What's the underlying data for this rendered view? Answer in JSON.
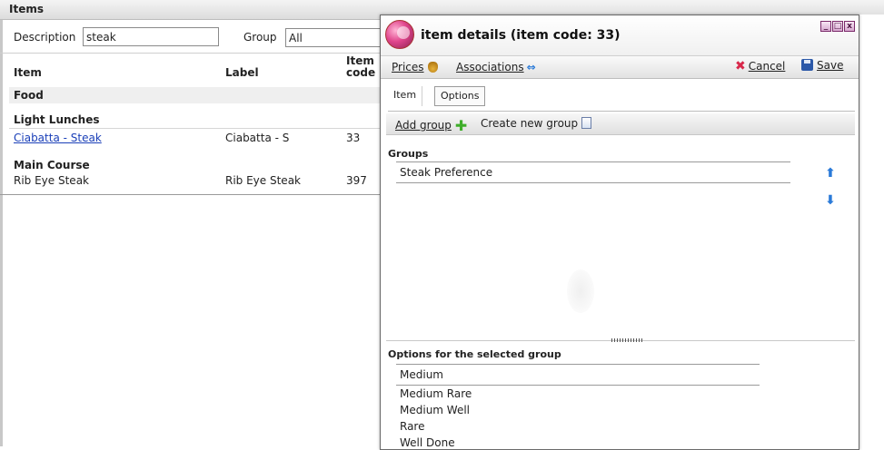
{
  "items_window": {
    "title": "Items",
    "filter": {
      "description_label": "Description",
      "description_value": "steak",
      "group_label": "Group",
      "group_value": "All"
    },
    "columns": {
      "item": "Item",
      "label": "Label",
      "item_code_line1": "Item",
      "item_code_line2": "code"
    },
    "group_name": "Food",
    "sections": [
      {
        "name": "Light Lunches",
        "rows": [
          {
            "item": "Ciabatta - Steak",
            "label": "Ciabatta - S",
            "code": "33"
          }
        ]
      },
      {
        "name": "Main Course",
        "rows": [
          {
            "item": "Rib Eye Steak",
            "label": "Rib Eye Steak",
            "code": "397"
          }
        ]
      }
    ]
  },
  "dialog": {
    "title": "item details (item code: 33)",
    "window_buttons": [
      "_",
      "□",
      "x"
    ],
    "toolbar": {
      "prices_label": "Prices",
      "associations_label": "Associations",
      "cancel_label": "Cancel",
      "save_label": "Save"
    },
    "tabs": [
      {
        "label": "Item",
        "active": false
      },
      {
        "label": "Options",
        "active": true
      }
    ],
    "subbar": {
      "add_group_label": "Add group",
      "create_new_group_label": "Create new group"
    },
    "groups_title": "Groups",
    "groups": [
      "Steak Preference"
    ],
    "options_title": "Options for the selected group",
    "options": [
      "Medium",
      "Medium Rare",
      "Medium Well",
      "Rare",
      "Well Done"
    ]
  },
  "colors": {
    "link": "#1a3fb8",
    "cancel_icon": "#d8284a",
    "save_icon": "#2b58a8",
    "arrow_icon": "#2a7ad8",
    "add_icon": "#3fae2a"
  },
  "icons": {
    "prices": "money-bag-icon",
    "associations": "double-arrow-icon",
    "cancel": "x-icon",
    "save": "floppy-disk-icon",
    "add_group": "plus-icon",
    "create_new_group": "document-icon",
    "move_up": "arrow-up-icon",
    "move_down": "arrow-down-icon"
  }
}
